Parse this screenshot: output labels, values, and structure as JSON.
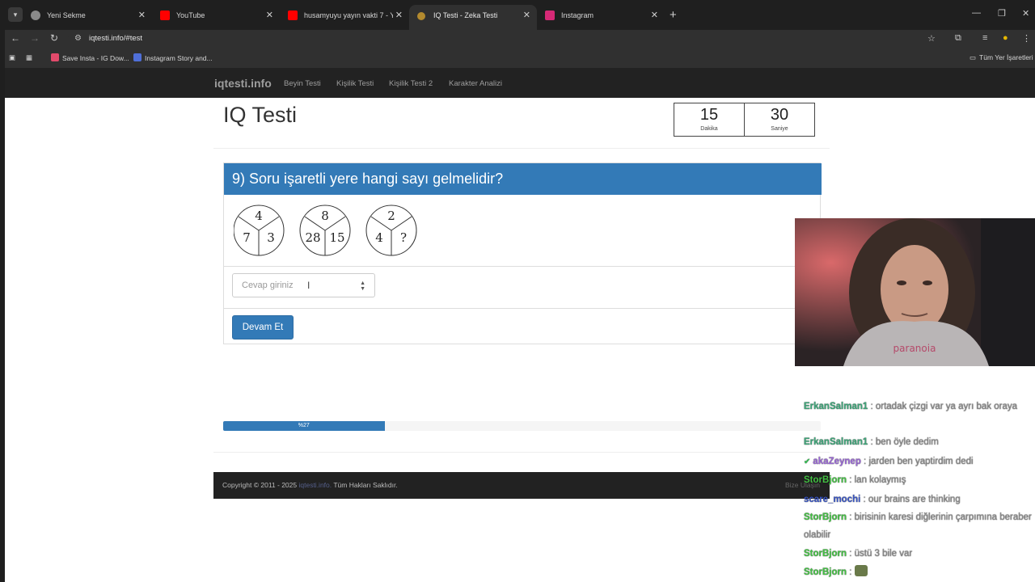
{
  "browser": {
    "tabs": [
      {
        "title": "Yeni Sekme",
        "color": "#8a8a8a"
      },
      {
        "title": "YouTube",
        "color": "#ff0000"
      },
      {
        "title": "husamyuyu yayın vakti 7 - YouT",
        "color": "#ff0000"
      },
      {
        "title": "IQ Testi - Zeka Testi",
        "color": "#b38a2e"
      },
      {
        "title": "Instagram",
        "color": "#d62976"
      }
    ],
    "url": "iqtesti.info/#test",
    "bookmarks": [
      {
        "label": "Save Insta - IG Dow...",
        "color": "#e24a6b"
      },
      {
        "label": "Instagram Story and...",
        "color": "#4f6fd8"
      }
    ],
    "all_bookmarks_label": "Tüm Yer İşaretleri"
  },
  "site": {
    "brand": "iqtesti.info",
    "nav": [
      "Beyin Testi",
      "Kişilik Testi",
      "Kişilik Testi 2",
      "Karakter Analizi"
    ],
    "title": "IQ Testi",
    "timer": {
      "minutes": "15",
      "minutes_label": "Dakika",
      "seconds": "30",
      "seconds_label": "Saniye"
    },
    "question": "9) Soru işaretli yere hangi sayı gelmelidir?",
    "puzzles": [
      {
        "top": "4",
        "left": "7",
        "right": "3"
      },
      {
        "top": "8",
        "left": "28",
        "right": "15"
      },
      {
        "top": "2",
        "left": "4",
        "right": "?"
      }
    ],
    "answer_placeholder": "Cevap giriniz",
    "submit_label": "Devam Et",
    "progress": {
      "label": "%27",
      "value": 27
    },
    "footer": {
      "copyright": "Copyright © 2011 - 2025",
      "link": "iqtesti.info.",
      "rights": "Tüm Hakları Saklıdır.",
      "contact": "Bize Ulaşın"
    }
  },
  "chat": [
    {
      "user": "ErkanSalman1",
      "user_color": "#3fa67a",
      "text": "ortadak çizgi var ya ayrı bak oraya"
    },
    {
      "user": "ErkanSalman1",
      "user_color": "#3fa67a",
      "text": "ben öyle dedim"
    },
    {
      "user": "akaZeynep",
      "user_color": "#9b6ad6",
      "text": "jarden ben yaptirdim dedi",
      "badges": true
    },
    {
      "user": "StorBjorn",
      "user_color": "#45c145",
      "text": "lan kolaymış"
    },
    {
      "user": "scare_mochi",
      "user_color": "#3b57c4",
      "text": "our brains are thinking"
    },
    {
      "user": "StorBjorn",
      "user_color": "#45c145",
      "text": "birisinin karesi diğlerinin çarpımına beraber olabilir"
    },
    {
      "user": "StorBjorn",
      "user_color": "#45c145",
      "text": "üstü 3 bile var"
    },
    {
      "user": "StorBjorn",
      "user_color": "#45c145",
      "text": ""
    }
  ]
}
